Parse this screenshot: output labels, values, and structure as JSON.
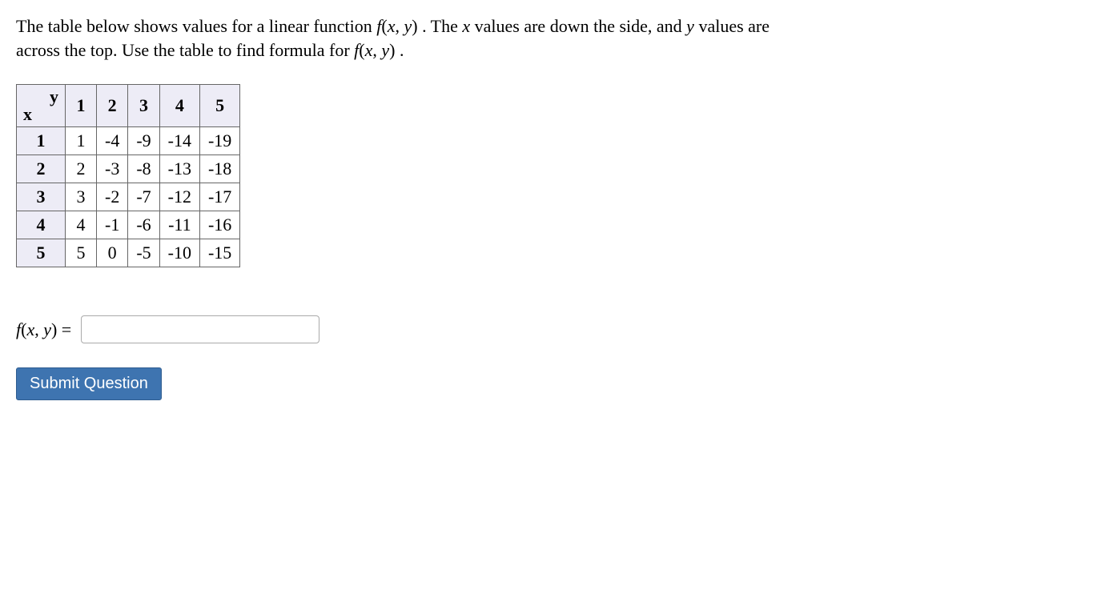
{
  "prompt": {
    "part1": "The table below shows values for a linear function ",
    "fxy": "f(x, y)",
    "part2": ". The ",
    "xvar": "x",
    "part3": " values are down the side, and ",
    "yvar": "y",
    "part4": " values are across the top. Use the table to find formula for ",
    "fxy2": "f(x, y)",
    "part5": "."
  },
  "table": {
    "corner_x": "x",
    "corner_y": "y",
    "y_headers": [
      "1",
      "2",
      "3",
      "4",
      "5"
    ],
    "x_headers": [
      "1",
      "2",
      "3",
      "4",
      "5"
    ],
    "rows": [
      [
        "1",
        "-4",
        "-9",
        "-14",
        "-19"
      ],
      [
        "2",
        "-3",
        "-8",
        "-13",
        "-18"
      ],
      [
        "3",
        "-2",
        "-7",
        "-12",
        "-17"
      ],
      [
        "4",
        "-1",
        "-6",
        "-11",
        "-16"
      ],
      [
        "5",
        "0",
        "-5",
        "-10",
        "-15"
      ]
    ]
  },
  "answer": {
    "lhs": "f(x, y) =",
    "value": ""
  },
  "submit_label": "Submit Question"
}
